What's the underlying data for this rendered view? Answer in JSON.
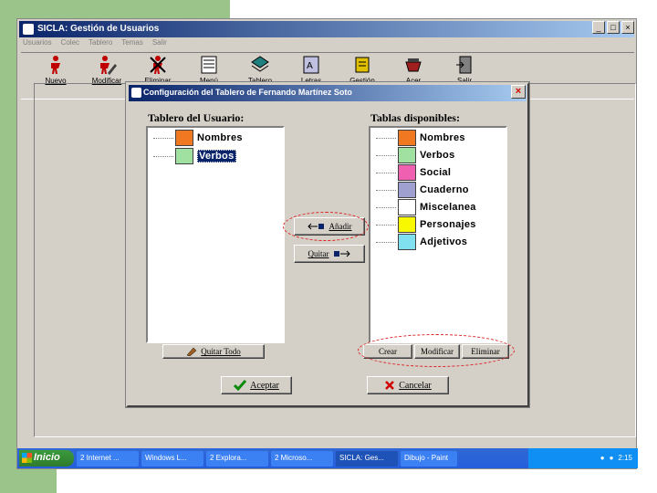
{
  "app": {
    "title": "SICLA: Gestión de Usuarios",
    "menu": [
      "Usuarios",
      "Colec",
      "Tablero",
      "Temas",
      "Salir"
    ],
    "toolbar": [
      {
        "label": "Nuevo",
        "icon": "new-user-icon",
        "color": "#c00000"
      },
      {
        "label": "Modificar",
        "icon": "modify-user-icon",
        "color": "#c00000"
      },
      {
        "label": "Eliminar",
        "icon": "delete-user-icon",
        "color": "#c00000"
      },
      {
        "label": "Menú",
        "icon": "menu-icon",
        "color": "#ffffff"
      },
      {
        "label": "Tablero",
        "icon": "board-icon",
        "color": "#208080"
      },
      {
        "label": "Letras",
        "icon": "letters-icon",
        "color": "#8080c0"
      },
      {
        "label": "Gestión",
        "icon": "management-icon",
        "color": "#e0c000"
      },
      {
        "label": "Acer",
        "icon": "acer-icon",
        "color": "#a02020"
      },
      {
        "label": "Salir",
        "icon": "exit-icon",
        "color": "#404040"
      }
    ]
  },
  "dialog": {
    "title": "Configuración del Tablero de Fernando Martínez Soto",
    "left_label": "Tablero del Usuario:",
    "right_label": "Tablas disponibles:",
    "user_items": [
      {
        "label": "Nombres",
        "color": "#f07820",
        "selected": false
      },
      {
        "label": "Verbos",
        "color": "#a0e0a0",
        "selected": true
      }
    ],
    "available_items": [
      {
        "label": "Nombres",
        "color": "#f07820"
      },
      {
        "label": "Verbos",
        "color": "#a0e0a0"
      },
      {
        "label": "Social",
        "color": "#f060b0"
      },
      {
        "label": "Cuaderno",
        "color": "#a0a0d0"
      },
      {
        "label": "Miscelanea",
        "color": "#ffffff"
      },
      {
        "label": "Personajes",
        "color": "#f8f800"
      },
      {
        "label": "Adjetivos",
        "color": "#80e0f0"
      }
    ],
    "buttons": {
      "add": "Añadir",
      "remove": "Quitar",
      "remove_all": "Quitar Todo",
      "create": "Crear",
      "modify": "Modificar",
      "delete": "Eliminar",
      "accept": "Aceptar",
      "cancel": "Cancelar"
    }
  },
  "taskbar": {
    "start": "Inicio",
    "tasks": [
      "2 Internet ...",
      "Windows L...",
      "2 Explora...",
      "2 Microso...",
      "SICLA: Ges...",
      "Dibujo - Paint"
    ],
    "tray_time": "2:15"
  }
}
